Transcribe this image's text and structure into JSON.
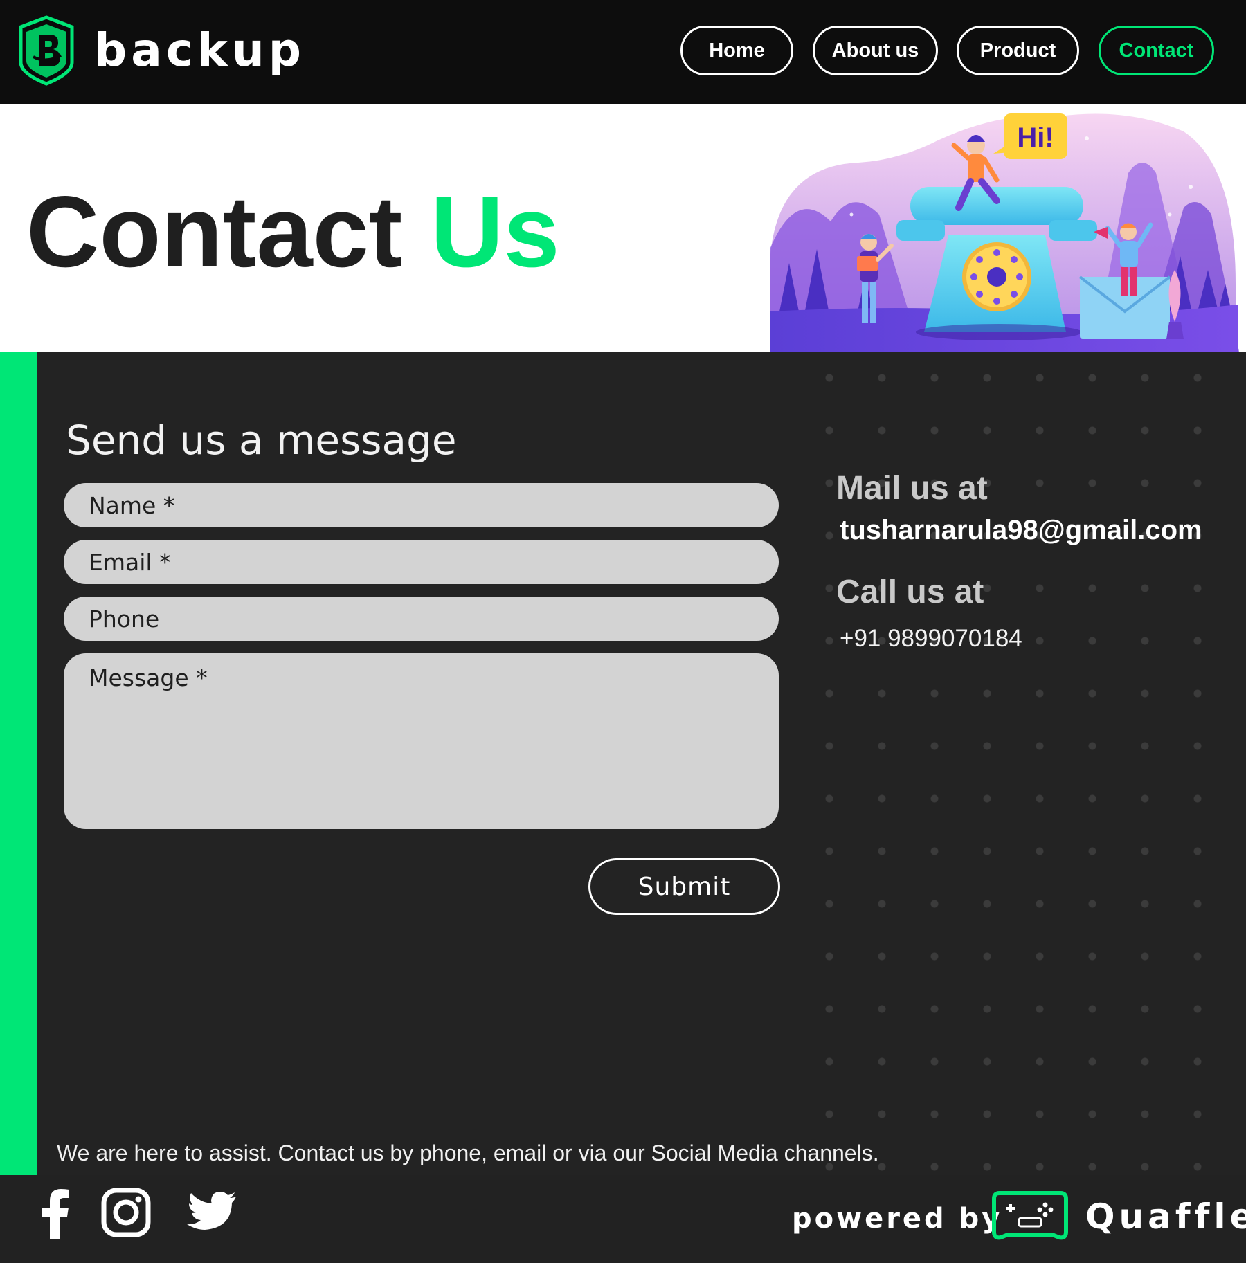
{
  "header": {
    "logo_text": "backup",
    "nav": [
      {
        "label": "Home"
      },
      {
        "label": "About us"
      },
      {
        "label": "Product"
      },
      {
        "label": "Contact",
        "active": true
      }
    ]
  },
  "hero": {
    "title_main": "Contact ",
    "title_accent": "Us",
    "bubble_text": "Hi!"
  },
  "form": {
    "title": "Send us a message",
    "name_placeholder": "Name *",
    "email_placeholder": "Email *",
    "phone_placeholder": "Phone",
    "message_placeholder": "Message *",
    "submit_label": "Submit"
  },
  "contact": {
    "mail_label": "Mail us at",
    "email": "tusharnarula98@gmail.com",
    "call_label": "Call us at",
    "phone": "+91 9899070184"
  },
  "assist_text": "We are here to assist. Contact us by phone, email or via our Social Media channels.",
  "footer": {
    "social_icons": [
      "facebook-icon",
      "instagram-icon",
      "twitter-icon"
    ],
    "powered_by": "powered by",
    "brand": "Quaffle"
  },
  "colors": {
    "accent": "#00e676",
    "header_bg": "#0d0d0d",
    "main_bg": "#232323",
    "field_bg": "#d3d3d3"
  }
}
